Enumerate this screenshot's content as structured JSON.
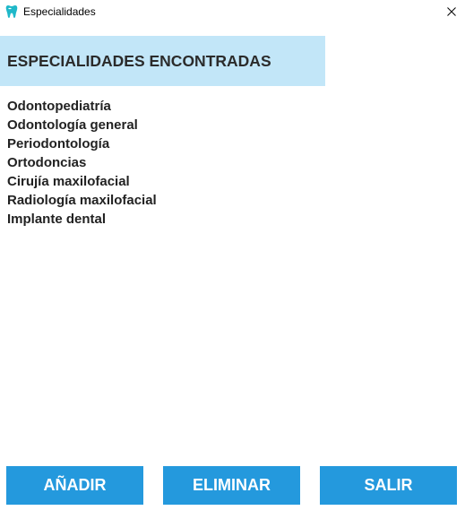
{
  "window": {
    "title": "Especialidades",
    "app_icon": "tooth-icon",
    "close_icon": "close-icon"
  },
  "header": {
    "title": "ESPECIALIDADES ENCONTRADAS"
  },
  "specialties": [
    "Odontopediatría",
    "Odontología general",
    "Periodontología",
    "Ortodoncias",
    "Cirujía maxilofacial",
    "Radiología maxilofacial",
    "Implante dental"
  ],
  "buttons": {
    "add_label": "AÑADIR",
    "delete_label": "ELIMINAR",
    "exit_label": "SALIR"
  },
  "colors": {
    "accent": "#2499dd",
    "header_bg": "#c2e6f8",
    "icon": "#1fb8c9"
  }
}
